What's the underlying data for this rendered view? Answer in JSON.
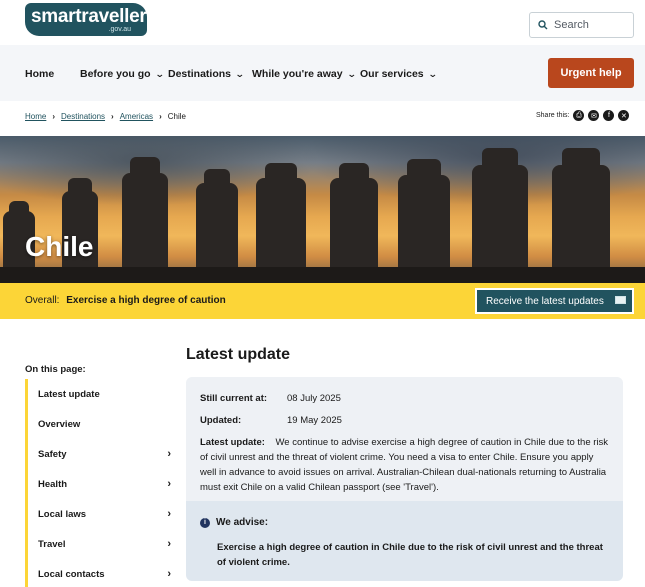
{
  "header": {
    "logo_text": "smartraveller",
    "logo_sub": ".gov.au",
    "search_placeholder": "Search"
  },
  "nav": {
    "items": [
      {
        "label": "Home"
      },
      {
        "label": "Before you go"
      },
      {
        "label": "Destinations"
      },
      {
        "label": "While you're away"
      },
      {
        "label": "Our services"
      }
    ],
    "urgent_label": "Urgent help"
  },
  "breadcrumb": [
    "Home",
    "Destinations",
    "Americas",
    "Chile"
  ],
  "share_label": "Share this:",
  "hero": {
    "title": "Chile"
  },
  "advice": {
    "prefix": "Overall:",
    "level": "Exercise a high degree of caution",
    "subscribe_label": "Receive the latest updates"
  },
  "sidebar": {
    "heading": "On this page:",
    "items": [
      {
        "label": "Latest update"
      },
      {
        "label": "Overview"
      },
      {
        "label": "Safety"
      },
      {
        "label": "Health"
      },
      {
        "label": "Local laws"
      },
      {
        "label": "Travel"
      },
      {
        "label": "Local contacts"
      }
    ]
  },
  "main": {
    "title": "Latest update",
    "still_current_label": "Still current at:",
    "still_current_value": "08 July 2025",
    "updated_label": "Updated:",
    "updated_value": "19 May 2025",
    "latest_label": "Latest update:",
    "latest_text": "We continue to advise exercise a high degree of caution in Chile due to the risk of civil unrest and the threat of violent crime. You need a visa to enter Chile. Ensure you apply well in advance to avoid issues on arrival. Australian-Chilean dual-nationals returning to Australia must exit Chile on a valid Chilean passport (see 'Travel').",
    "advise_heading": "We advise:",
    "advise_text": "Exercise a high degree of caution in Chile due to the risk of civil unrest and the threat of violent crime."
  },
  "colors": {
    "brand": "#21535f",
    "urgent": "#b9471d",
    "advice_yellow": "#fcd537"
  }
}
